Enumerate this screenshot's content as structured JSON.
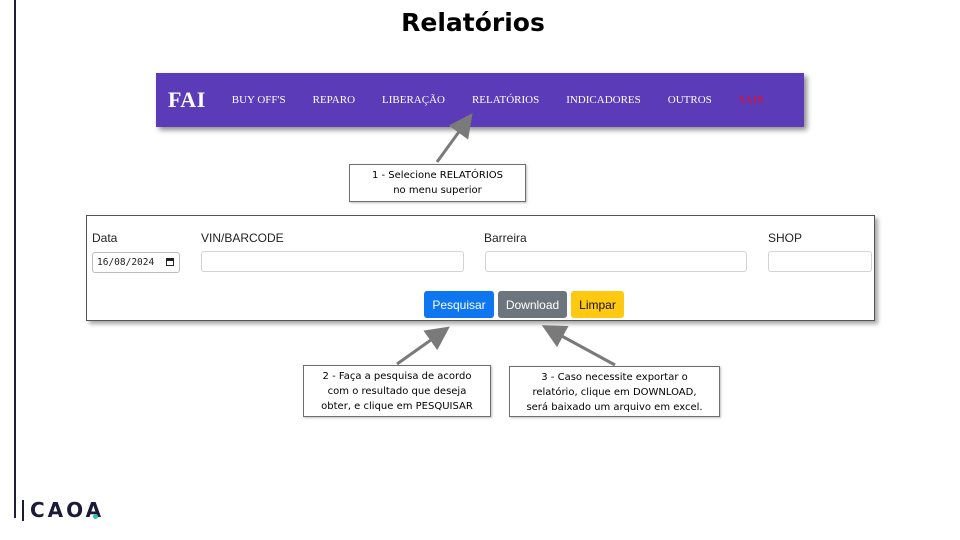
{
  "slide": {
    "title": "Relatórios"
  },
  "navbar": {
    "brand": "FAI",
    "items": [
      {
        "label": "BUY OFF'S"
      },
      {
        "label": "REPARO"
      },
      {
        "label": "LIBERAÇÃO"
      },
      {
        "label": "RELATÓRIOS"
      },
      {
        "label": "INDICADORES"
      },
      {
        "label": "OUTROS"
      },
      {
        "label": "SAIR"
      }
    ],
    "background": "#5b3bb8",
    "exit_color": "#e0112e"
  },
  "callouts": {
    "step1": {
      "line1": "1 - Selecione RELATÓRIOS",
      "line2": "no menu superior"
    },
    "step2": {
      "line1": "2 - Faça a pesquisa de acordo",
      "line2": "com o resultado que deseja",
      "line3": "obter, e clique em PESQUISAR"
    },
    "step3": {
      "line1": "3 - Caso necessite exportar o",
      "line2": "relatório, clique em DOWNLOAD,",
      "line3": "será baixado um arquivo em excel."
    }
  },
  "form": {
    "data_label": "Data",
    "data_value": "16/08/2024",
    "vin_label": "VIN/BARCODE",
    "vin_value": "",
    "barreira_label": "Barreira",
    "barreira_value": "",
    "shop_label": "SHOP",
    "shop_value": "",
    "buttons": {
      "search": "Pesquisar",
      "download": "Download",
      "clear": "Limpar"
    },
    "colors": {
      "search": "#0d76f0",
      "download": "#6c757d",
      "clear": "#ffc911"
    }
  },
  "logo": {
    "text": "CAOA"
  }
}
